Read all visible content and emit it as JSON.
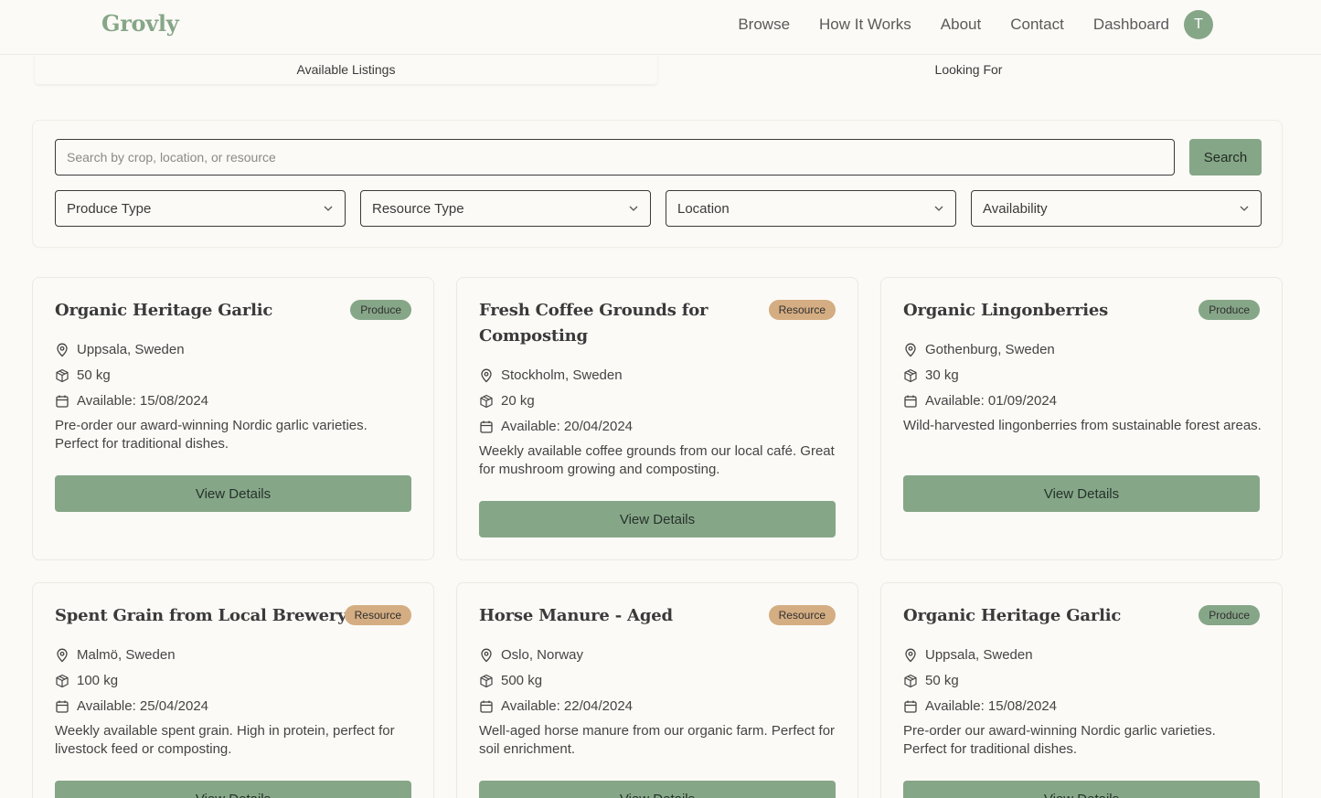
{
  "header": {
    "logo": "Grovly",
    "nav": [
      "Browse",
      "How It Works",
      "About",
      "Contact",
      "Dashboard"
    ],
    "avatar_initial": "T"
  },
  "tabs": [
    "Available Listings",
    "Looking For"
  ],
  "search": {
    "placeholder": "Search by crop, location, or resource",
    "button": "Search",
    "filters": [
      "Produce Type",
      "Resource Type",
      "Location",
      "Availability"
    ]
  },
  "colors": {
    "primary": "#86a688",
    "produce_badge": "#86a688",
    "resource_badge": "#d4ad82",
    "background": "#fbfaf6"
  },
  "listings": [
    {
      "title": "Organic Heritage Garlic",
      "badge": "Produce",
      "location": "Uppsala, Sweden",
      "quantity": "50 kg",
      "available": "Available: 15/08/2024",
      "description": "Pre-order our award-winning Nordic garlic varieties. Perfect for traditional dishes.",
      "button": "View Details"
    },
    {
      "title": "Fresh Coffee Grounds for Composting",
      "badge": "Resource",
      "location": "Stockholm, Sweden",
      "quantity": "20 kg",
      "available": "Available: 20/04/2024",
      "description": "Weekly available coffee grounds from our local café. Great for mushroom growing and composting.",
      "button": "View Details"
    },
    {
      "title": "Organic Lingonberries",
      "badge": "Produce",
      "location": "Gothenburg, Sweden",
      "quantity": "30 kg",
      "available": "Available: 01/09/2024",
      "description": "Wild-harvested lingonberries from sustainable forest areas.",
      "button": "View Details"
    },
    {
      "title": "Spent Grain from Local Brewery",
      "badge": "Resource",
      "location": "Malmö, Sweden",
      "quantity": "100 kg",
      "available": "Available: 25/04/2024",
      "description": "Weekly available spent grain. High in protein, perfect for livestock feed or composting.",
      "button": "View Details"
    },
    {
      "title": "Horse Manure - Aged",
      "badge": "Resource",
      "location": "Oslo, Norway",
      "quantity": "500 kg",
      "available": "Available: 22/04/2024",
      "description": "Well-aged horse manure from our organic farm. Perfect for soil enrichment.",
      "button": "View Details"
    },
    {
      "title": "Organic Heritage Garlic",
      "badge": "Produce",
      "location": "Uppsala, Sweden",
      "quantity": "50 kg",
      "available": "Available: 15/08/2024",
      "description": "Pre-order our award-winning Nordic garlic varieties. Perfect for traditional dishes.",
      "button": "View Details"
    }
  ]
}
